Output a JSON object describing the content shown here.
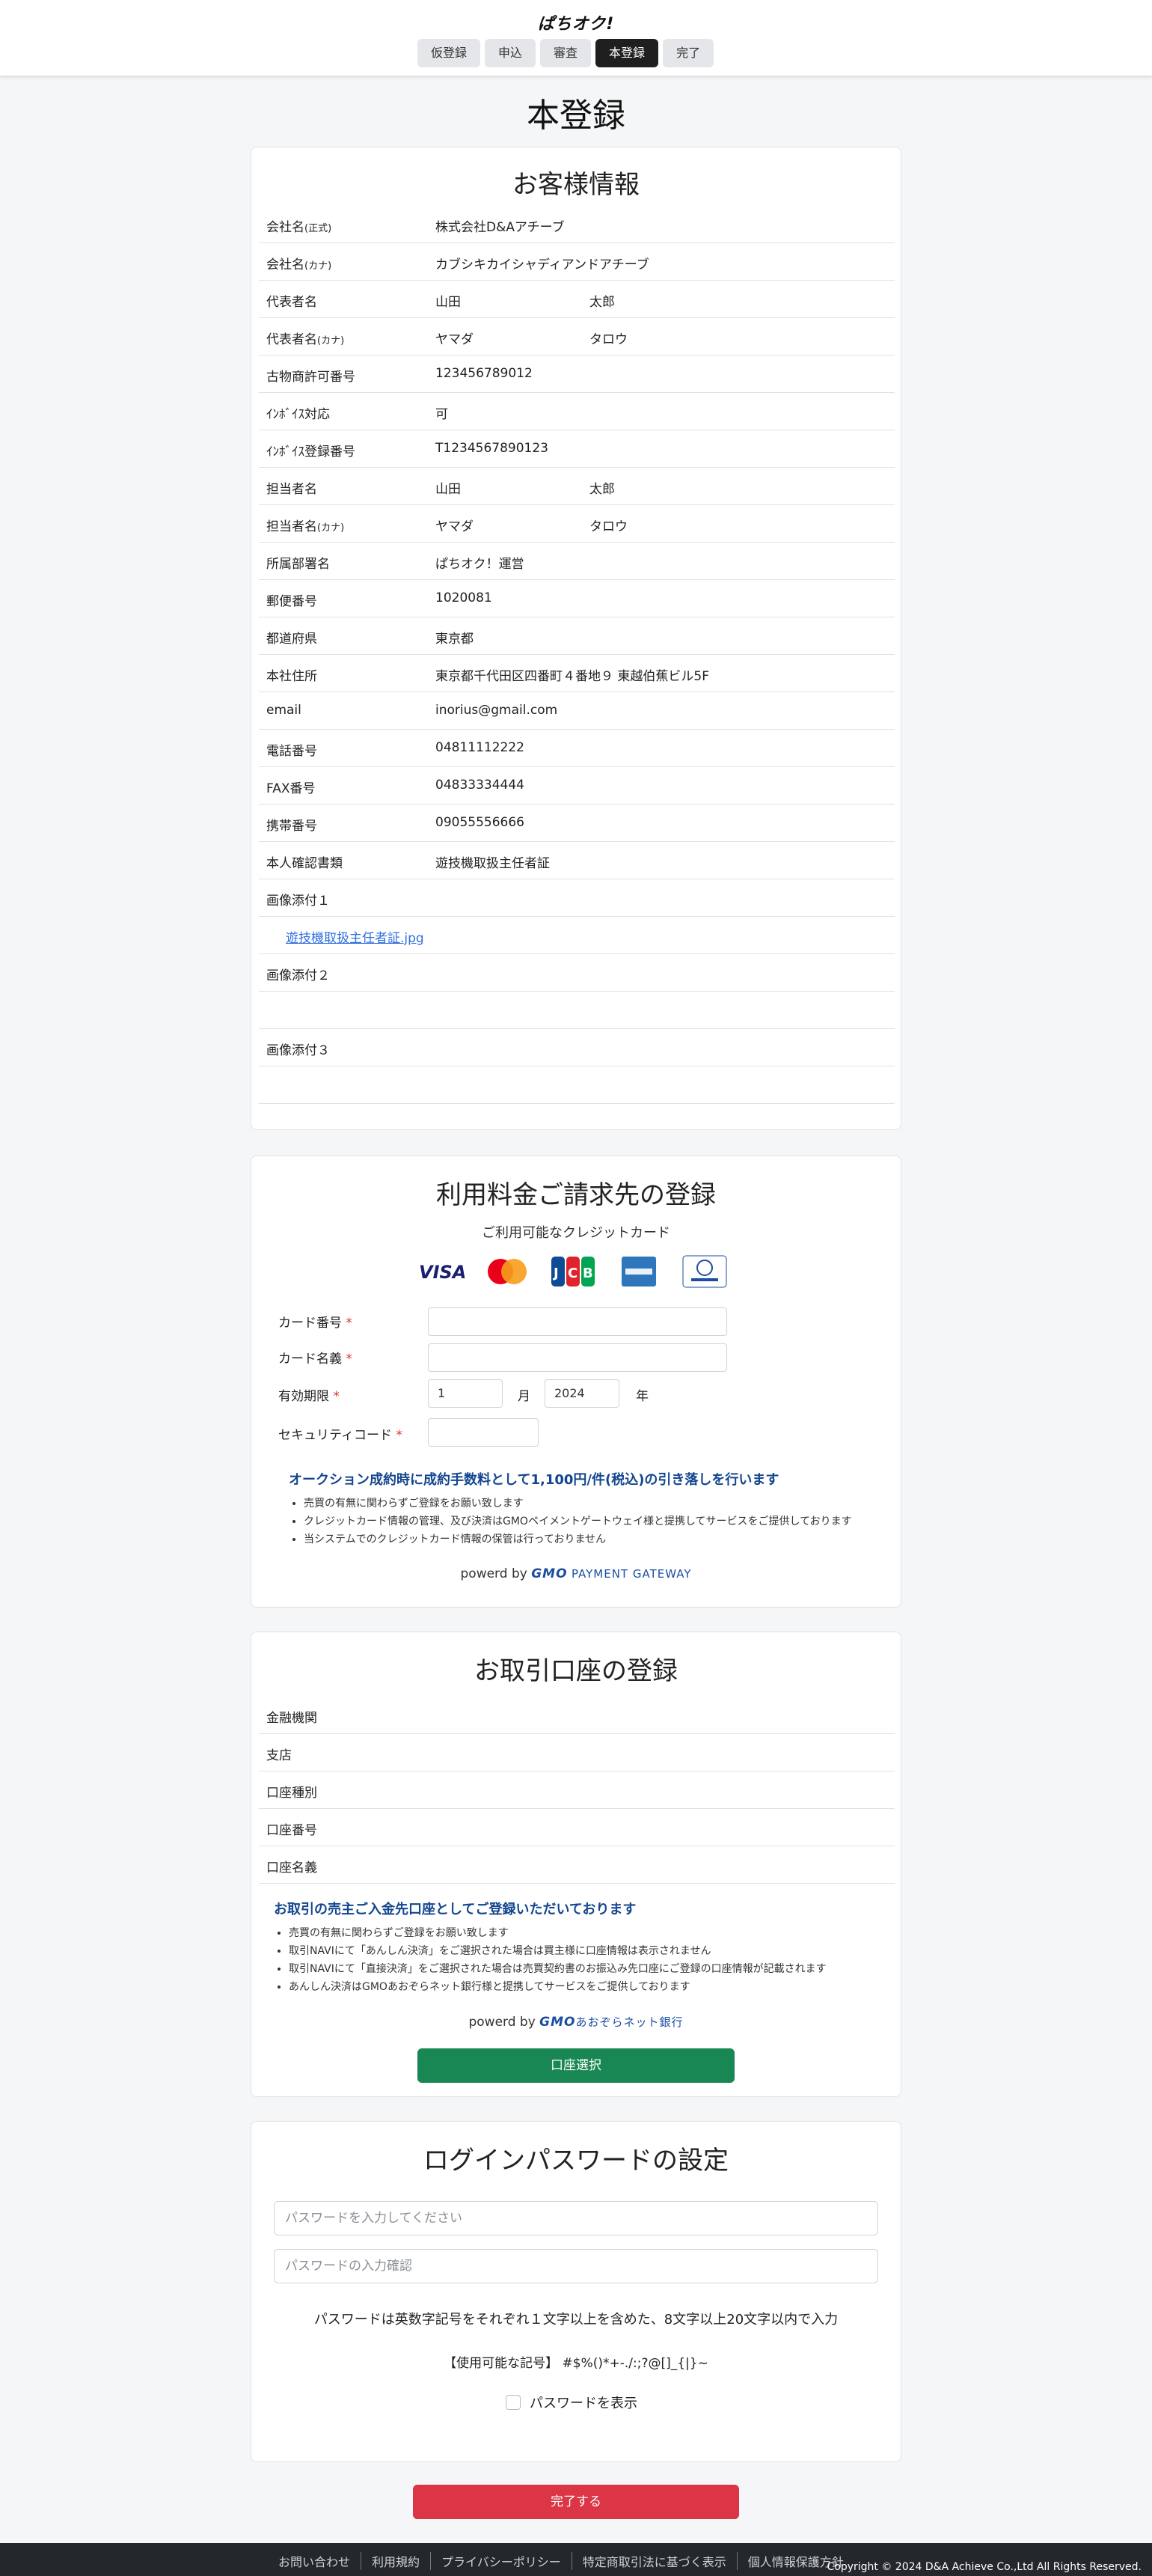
{
  "header": {
    "logo": "ぱちオク!",
    "steps": [
      "仮登録",
      "申込",
      "審査",
      "本登録",
      "完了"
    ],
    "active_step": "本登録"
  },
  "page_title": "本登録",
  "customer": {
    "title": "お客様情報",
    "rows": [
      {
        "label": "会社名",
        "label_small": "(正式)",
        "value": "株式会社D&Aアチーブ"
      },
      {
        "label": "会社名",
        "label_small": "(カナ)",
        "value": "カブシキカイシャディアンドアチーブ"
      },
      {
        "label": "代表者名",
        "label_small": "",
        "value": "山田",
        "value2": "太郎"
      },
      {
        "label": "代表者名",
        "label_small": "(カナ)",
        "value": "ヤマダ",
        "value2": "タロウ"
      },
      {
        "label": "古物商許可番号",
        "label_small": "",
        "value": "123456789012"
      },
      {
        "label": "ｲﾝﾎﾞｲｽ対応",
        "label_small": "",
        "value": "可"
      },
      {
        "label": "ｲﾝﾎﾞｲｽ登録番号",
        "label_small": "",
        "value": "T1234567890123"
      },
      {
        "label": "担当者名",
        "label_small": "",
        "value": "山田",
        "value2": "太郎"
      },
      {
        "label": "担当者名",
        "label_small": "(カナ)",
        "value": "ヤマダ",
        "value2": "タロウ"
      },
      {
        "label": "所属部署名",
        "label_small": "",
        "value": "ぱちオク！運営"
      },
      {
        "label": "郵便番号",
        "label_small": "",
        "value": "1020081"
      },
      {
        "label": "都道府県",
        "label_small": "",
        "value": "東京都"
      },
      {
        "label": "本社住所",
        "label_small": "",
        "value": "東京都千代田区四番町４番地９ 東越伯蕉ビル5F"
      },
      {
        "label": "email",
        "label_small": "",
        "value": "inorius@gmail.com"
      },
      {
        "label": "電話番号",
        "label_small": "",
        "value": "04811112222"
      },
      {
        "label": "FAX番号",
        "label_small": "",
        "value": "04833334444"
      },
      {
        "label": "携帯番号",
        "label_small": "",
        "value": "09055556666"
      },
      {
        "label": "本人確認書類",
        "label_small": "",
        "value": "遊技機取扱主任者証"
      }
    ],
    "image1_label": "画像添付１",
    "image1_file": "遊技機取扱主任者証.jpg",
    "image2_label": "画像添付２",
    "image3_label": "画像添付３"
  },
  "billing": {
    "title": "利用料金ご請求先の登録",
    "subtitle": "ご利用可能なクレジットカード",
    "card_brands": [
      "VISA",
      "Mastercard",
      "JCB",
      "AMERICAN EXPRESS",
      "Diners Club"
    ],
    "card_number_label": "カード番号",
    "card_name_label": "カード名義",
    "expiry_label": "有効期限",
    "expiry_month": "1",
    "month_unit": "月",
    "expiry_year": "2024",
    "year_unit": "年",
    "security_label": "セキュリティコード",
    "required_mark": "*",
    "notice": "オークション成約時に成約手数料として1,100円/件(税込)の引き落しを行います",
    "notes": [
      "売買の有無に関わらずご登録をお願い致します",
      "クレジットカード情報の管理、及び決済はGMOペイメントゲートウェイ様と提携してサービスをご提供しております",
      "当システムでのクレジットカード情報の保管は行っておりません"
    ],
    "powered_by": "powerd by",
    "provider_logo": "GMO",
    "provider_name": "PAYMENT GATEWAY"
  },
  "account": {
    "title": "お取引口座の登録",
    "rows": [
      "金融機関",
      "支店",
      "口座種別",
      "口座番号",
      "口座名義"
    ],
    "notice": "お取引の売主ご入金先口座としてご登録いただいております",
    "notes": [
      "売買の有無に関わらずご登録をお願い致します",
      "取引NAVIにて「あんしん決済」をご選択された場合は買主様に口座情報は表示されません",
      "取引NAVIにて「直接決済」をご選択された場合は売買契約書のお振込み先口座にご登録の口座情報が記載されます",
      "あんしん決済はGMOあおぞらネット銀行様と提携してサービスをご提供しております"
    ],
    "powered_by": "powerd by",
    "provider_logo": "GMO",
    "provider_name": "あおぞらネット銀行",
    "select_button": "口座選択"
  },
  "password": {
    "title": "ログインパスワードの設定",
    "placeholder": "パスワードを入力してください",
    "confirm_placeholder": "パスワードの入力確認",
    "rule": "パスワードは英数字記号をそれぞれ１文字以上を含めた、8文字以上20文字以内で入力",
    "symbols": "【使用可能な記号】 #$%()*+-./:;?@[]_{|}~",
    "show_label": "パスワードを表示"
  },
  "submit_button": "完了する",
  "footer": {
    "links": [
      "お問い合わせ",
      "利用規約",
      "プライバシーポリシー",
      "特定商取引法に基づく表示",
      "個人情報保護方針"
    ],
    "copyright": "Copyright © 2024 D&A Achieve Co.,Ltd All Rights Reserved."
  },
  "colors": {
    "primary_green": "#198754",
    "danger_red": "#dc3545",
    "notice_blue": "#13468f",
    "link_blue": "#2f6fde",
    "footer_bg": "#24272b"
  }
}
